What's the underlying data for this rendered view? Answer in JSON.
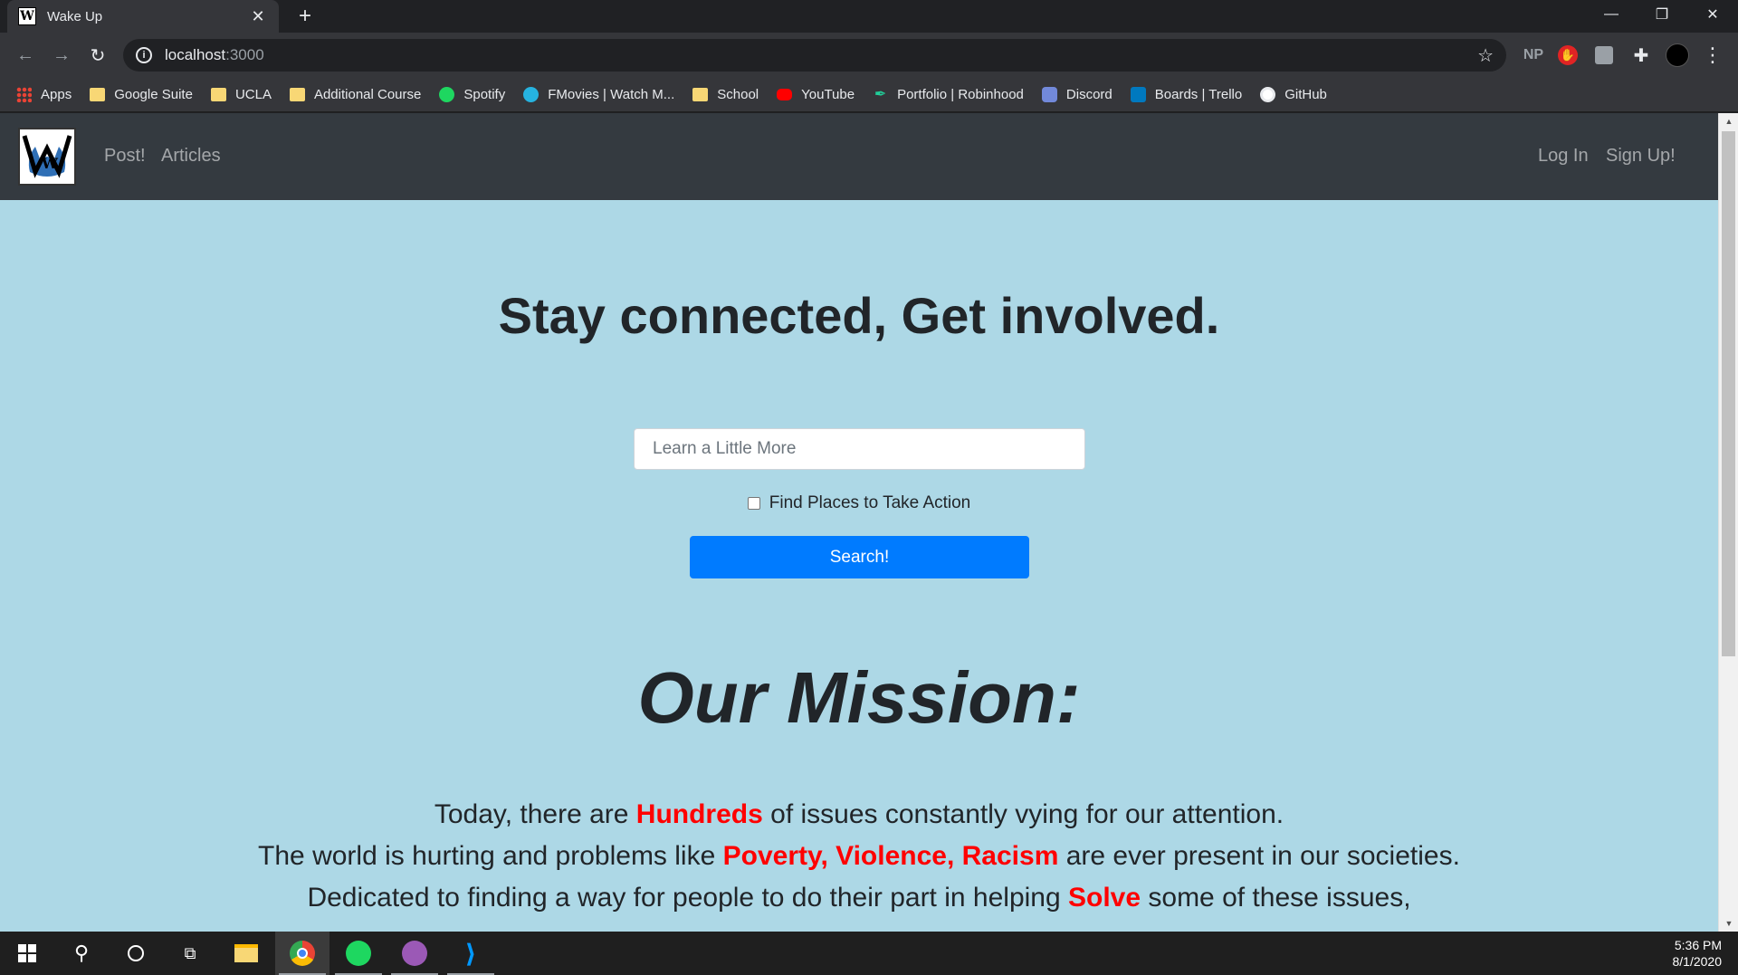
{
  "browser": {
    "tab_title": "Wake Up",
    "tab_favicon": "W",
    "url_host": "localhost",
    "url_port": ":3000",
    "extensions": {
      "np_label": "NP"
    }
  },
  "bookmarks": [
    {
      "label": "Apps",
      "icon": "apps-grid-icon"
    },
    {
      "label": "Google Suite",
      "icon": "folder-icon"
    },
    {
      "label": "UCLA",
      "icon": "folder-icon"
    },
    {
      "label": "Additional Course",
      "icon": "folder-icon"
    },
    {
      "label": "Spotify",
      "icon": "spotify-icon"
    },
    {
      "label": "FMovies | Watch M...",
      "icon": "fmovies-icon"
    },
    {
      "label": "School",
      "icon": "folder-icon"
    },
    {
      "label": "YouTube",
      "icon": "youtube-icon"
    },
    {
      "label": "Portfolio | Robinhood",
      "icon": "robinhood-icon"
    },
    {
      "label": "Discord",
      "icon": "discord-icon"
    },
    {
      "label": "Boards | Trello",
      "icon": "trello-icon"
    },
    {
      "label": "GitHub",
      "icon": "github-icon"
    }
  ],
  "navbar": {
    "links": [
      "Post!",
      "Articles"
    ],
    "login": "Log In",
    "signup": "Sign Up!"
  },
  "hero": {
    "title": "Stay connected, Get involved.",
    "search_placeholder": "Learn a Little More",
    "checkbox_label": "Find Places to Take Action",
    "checkbox_checked": false,
    "search_button": "Search!"
  },
  "mission": {
    "title": "Our Mission:",
    "line1_a": "Today, there are ",
    "line1_hl": "Hundreds",
    "line1_b": " of issues constantly vying for our attention.",
    "line2_a": "The world is hurting and problems like ",
    "line2_hl": "Poverty, Violence, Racism",
    "line2_b": " are ever present in our societies.",
    "line3_a": "Dedicated to finding a way for people to do their part in helping ",
    "line3_hl": "Solve",
    "line3_b": " some of these issues,"
  },
  "taskbar": {
    "time": "5:36 PM",
    "date": "8/1/2020"
  },
  "colors": {
    "page_bg": "#add8e6",
    "navbar_bg": "#343a40",
    "highlight": "#ff0000",
    "primary_button": "#007bff"
  }
}
